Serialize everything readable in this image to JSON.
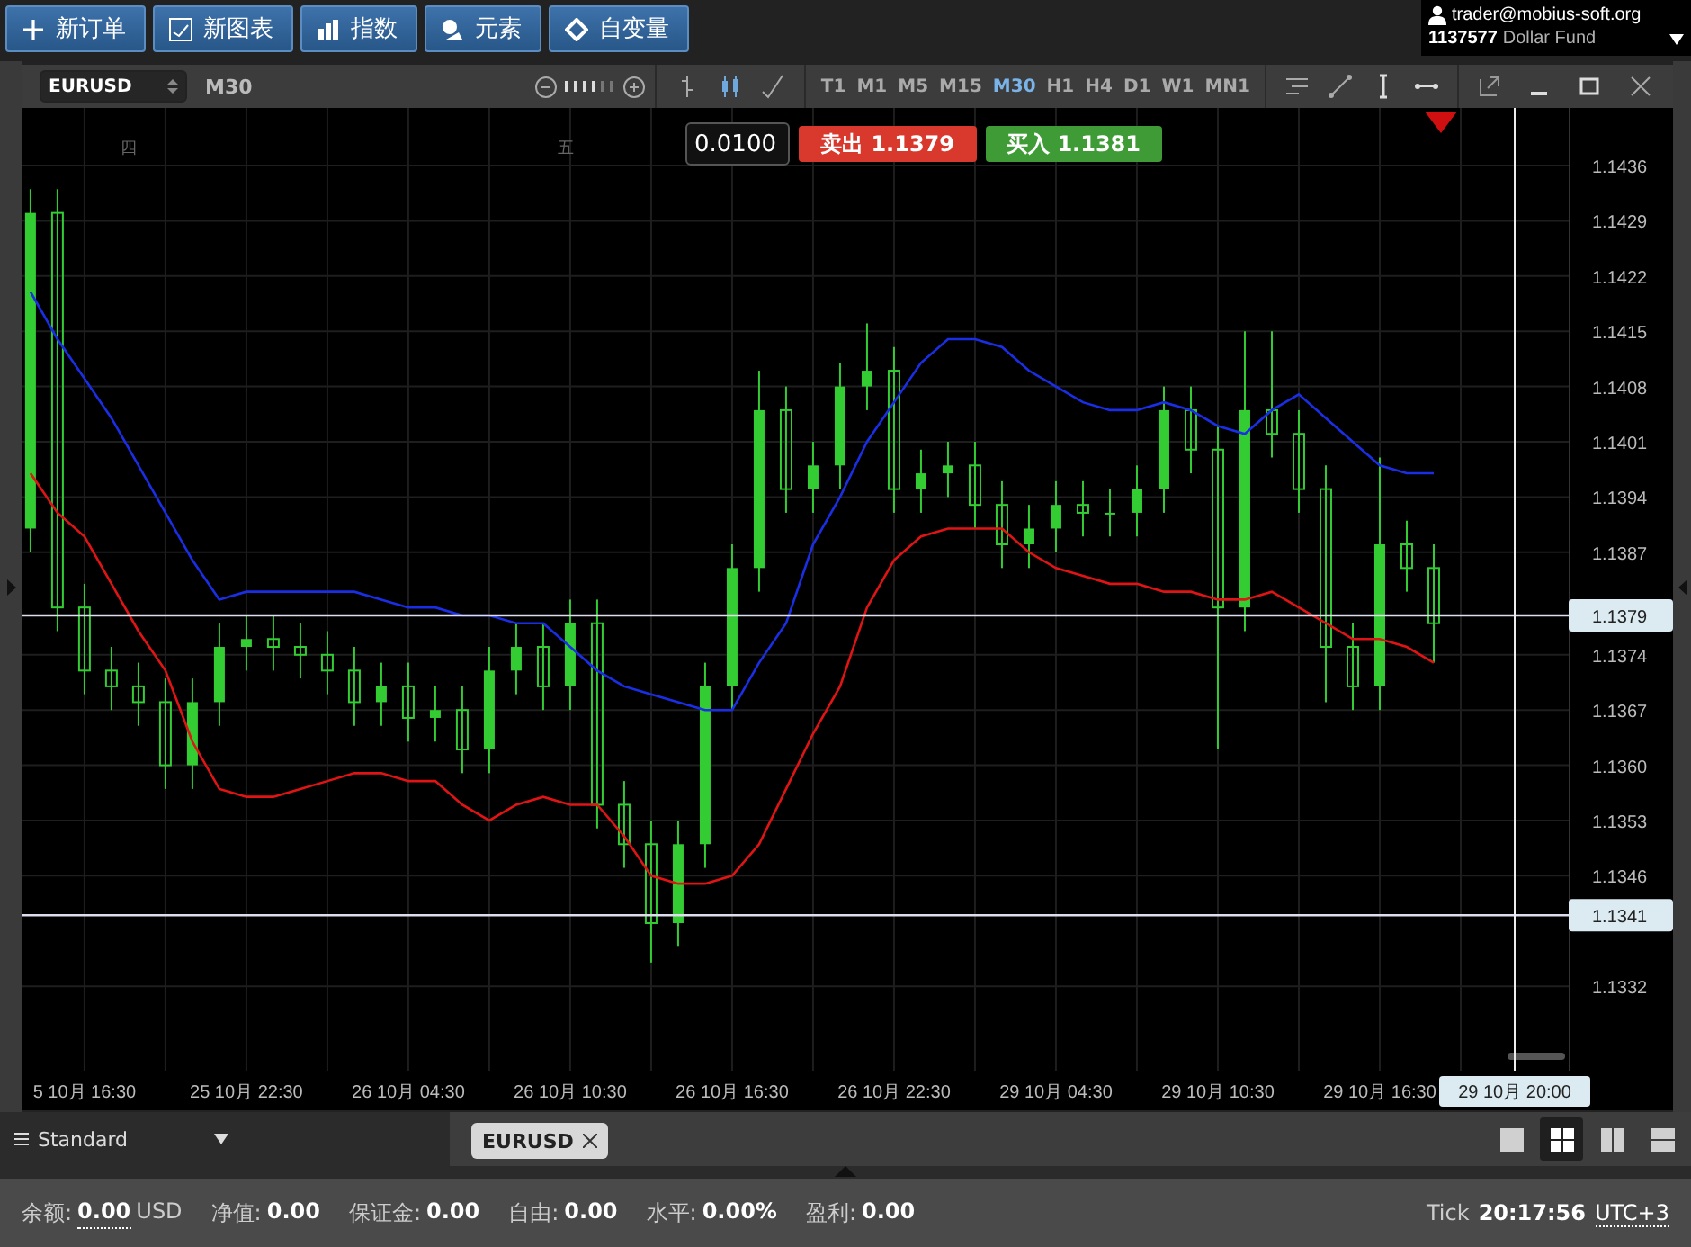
{
  "toolbar": {
    "buttons": [
      {
        "label": "新订单",
        "kind": "plus"
      },
      {
        "label": "新图表",
        "kind": "chart"
      },
      {
        "label": "指数",
        "kind": "bars"
      },
      {
        "label": "元素",
        "kind": "shapes"
      },
      {
        "label": "自变量",
        "kind": "diamond"
      }
    ]
  },
  "account": {
    "email": "trader@mobius-soft.org",
    "number": "1137577",
    "name": "Dollar Fund"
  },
  "chart_window": {
    "symbol": "EURUSD",
    "period": "M30",
    "timeframes": [
      {
        "label": "T1",
        "selected": false
      },
      {
        "label": "M1",
        "selected": false
      },
      {
        "label": "M5",
        "selected": false
      },
      {
        "label": "M15",
        "selected": false
      },
      {
        "label": "M30",
        "selected": true
      },
      {
        "label": "H1",
        "selected": false
      },
      {
        "label": "H4",
        "selected": false
      },
      {
        "label": "D1",
        "selected": false
      },
      {
        "label": "W1",
        "selected": false
      },
      {
        "label": "MN1",
        "selected": false
      }
    ],
    "order_panel": {
      "lot": "0.0100",
      "sell": {
        "label": "卖出",
        "price": "1.1379"
      },
      "buy": {
        "label": "买入",
        "price": "1.1381"
      }
    },
    "day_marks": [
      {
        "label": "四"
      },
      {
        "label": "五"
      }
    ],
    "crosshair": {
      "time": "29 10月 20:00"
    },
    "chart_data": {
      "type": "candlestick",
      "grid": true,
      "categories": [
        null,
        null,
        "5 10月 16:30",
        null,
        null,
        null,
        null,
        null,
        "25 10月 22:30",
        null,
        null,
        null,
        null,
        null,
        "26 10月 04:30",
        null,
        null,
        null,
        null,
        null,
        "26 10月 10:30",
        null,
        null,
        null,
        null,
        null,
        "26 10月 16:30",
        null,
        null,
        null,
        null,
        null,
        "26 10月 22:30",
        null,
        null,
        null,
        null,
        null,
        "29 10月 04:30",
        null,
        null,
        null,
        null,
        null,
        "29 10月 10:30",
        null,
        null,
        null,
        null,
        null,
        "29 10月 16:30",
        null,
        null,
        null,
        null,
        null
      ],
      "ohlc": [
        [
          1.139,
          1.1433,
          1.1387,
          1.143
        ],
        [
          1.143,
          1.1433,
          1.1377,
          1.138
        ],
        [
          1.138,
          1.1383,
          1.1369,
          1.1372
        ],
        [
          1.1372,
          1.1375,
          1.1367,
          1.137
        ],
        [
          1.137,
          1.1373,
          1.1365,
          1.1368
        ],
        [
          1.1368,
          1.1371,
          1.1357,
          1.136
        ],
        [
          1.136,
          1.1371,
          1.1357,
          1.1368
        ],
        [
          1.1368,
          1.1378,
          1.1365,
          1.1375
        ],
        [
          1.1375,
          1.1379,
          1.1372,
          1.1376
        ],
        [
          1.1376,
          1.1379,
          1.1372,
          1.1375
        ],
        [
          1.1375,
          1.1378,
          1.1371,
          1.1374
        ],
        [
          1.1374,
          1.1377,
          1.1369,
          1.1372
        ],
        [
          1.1372,
          1.1375,
          1.1365,
          1.1368
        ],
        [
          1.1368,
          1.1373,
          1.1365,
          1.137
        ],
        [
          1.137,
          1.1373,
          1.1363,
          1.1366
        ],
        [
          1.1366,
          1.137,
          1.1363,
          1.1367
        ],
        [
          1.1367,
          1.137,
          1.1359,
          1.1362
        ],
        [
          1.1362,
          1.1375,
          1.1359,
          1.1372
        ],
        [
          1.1372,
          1.1378,
          1.1369,
          1.1375
        ],
        [
          1.1375,
          1.1378,
          1.1367,
          1.137
        ],
        [
          1.137,
          1.1381,
          1.1367,
          1.1378
        ],
        [
          1.1378,
          1.1381,
          1.1352,
          1.1355
        ],
        [
          1.1355,
          1.1358,
          1.1347,
          1.135
        ],
        [
          1.135,
          1.1353,
          1.1335,
          1.134
        ],
        [
          1.134,
          1.1353,
          1.1337,
          1.135
        ],
        [
          1.135,
          1.1373,
          1.1347,
          1.137
        ],
        [
          1.137,
          1.1388,
          1.1367,
          1.1385
        ],
        [
          1.1385,
          1.141,
          1.1382,
          1.1405
        ],
        [
          1.1405,
          1.1408,
          1.1392,
          1.1395
        ],
        [
          1.1395,
          1.1401,
          1.1392,
          1.1398
        ],
        [
          1.1398,
          1.1411,
          1.1395,
          1.1408
        ],
        [
          1.1408,
          1.1416,
          1.1405,
          1.141
        ],
        [
          1.141,
          1.1413,
          1.1392,
          1.1395
        ],
        [
          1.1395,
          1.14,
          1.1392,
          1.1397
        ],
        [
          1.1397,
          1.1401,
          1.1394,
          1.1398
        ],
        [
          1.1398,
          1.1401,
          1.139,
          1.1393
        ],
        [
          1.1393,
          1.1396,
          1.1385,
          1.1388
        ],
        [
          1.1388,
          1.1393,
          1.1385,
          1.139
        ],
        [
          1.139,
          1.1396,
          1.1387,
          1.1393
        ],
        [
          1.1393,
          1.1396,
          1.1389,
          1.1392
        ],
        [
          1.1392,
          1.1395,
          1.1389,
          1.1392
        ],
        [
          1.1392,
          1.1398,
          1.1389,
          1.1395
        ],
        [
          1.1395,
          1.1408,
          1.1392,
          1.1405
        ],
        [
          1.1405,
          1.1408,
          1.1397,
          1.14
        ],
        [
          1.14,
          1.1403,
          1.1362,
          1.138
        ],
        [
          1.138,
          1.1415,
          1.1377,
          1.1405
        ],
        [
          1.1405,
          1.1415,
          1.1399,
          1.1402
        ],
        [
          1.1402,
          1.1405,
          1.1392,
          1.1395
        ],
        [
          1.1395,
          1.1398,
          1.1368,
          1.1375
        ],
        [
          1.1375,
          1.1378,
          1.1367,
          1.137
        ],
        [
          1.137,
          1.1399,
          1.1367,
          1.1388
        ],
        [
          1.1388,
          1.1391,
          1.1382,
          1.1385
        ],
        [
          1.1385,
          1.1388,
          1.1373,
          1.1378
        ],
        null,
        null,
        null
      ],
      "series": [
        {
          "type": "line",
          "color": "#1a2ee6",
          "values": [
            1.142,
            1.1414,
            1.1409,
            1.1404,
            1.1398,
            1.1392,
            1.1386,
            1.1381,
            1.1382,
            1.1382,
            1.1382,
            1.1382,
            1.1382,
            1.1381,
            1.138,
            1.138,
            1.1379,
            1.1379,
            1.1378,
            1.1378,
            1.1375,
            1.1372,
            1.137,
            1.1369,
            1.1368,
            1.1367,
            1.1367,
            1.1373,
            1.1378,
            1.1388,
            1.1394,
            1.1401,
            1.1406,
            1.1411,
            1.1414,
            1.1414,
            1.1413,
            1.141,
            1.1408,
            1.1406,
            1.1405,
            1.1405,
            1.1406,
            1.1405,
            1.1403,
            1.1402,
            1.1405,
            1.1407,
            1.1404,
            1.1401,
            1.1398,
            1.1397,
            1.1397,
            null,
            null,
            null
          ]
        },
        {
          "type": "line",
          "color": "#e01414",
          "values": [
            1.1397,
            1.1392,
            1.1389,
            1.1383,
            1.1377,
            1.1372,
            1.1363,
            1.1357,
            1.1356,
            1.1356,
            1.1357,
            1.1358,
            1.1359,
            1.1359,
            1.1358,
            1.1358,
            1.1355,
            1.1353,
            1.1355,
            1.1356,
            1.1355,
            1.1355,
            1.1351,
            1.1346,
            1.1345,
            1.1345,
            1.1346,
            1.135,
            1.1357,
            1.1364,
            1.137,
            1.138,
            1.1386,
            1.1389,
            1.139,
            1.139,
            1.139,
            1.1387,
            1.1385,
            1.1384,
            1.1383,
            1.1383,
            1.1382,
            1.1382,
            1.1381,
            1.1381,
            1.1382,
            1.138,
            1.1378,
            1.1376,
            1.1376,
            1.1375,
            1.1373,
            null,
            null,
            null
          ]
        }
      ],
      "ylim": [
        1.13213,
        1.14433
      ],
      "yticks": [
        {
          "value": 1.1436,
          "label": "1.1436"
        },
        {
          "value": 1.1429,
          "label": "1.1429"
        },
        {
          "value": 1.1422,
          "label": "1.1422"
        },
        {
          "value": 1.1415,
          "label": "1.1415"
        },
        {
          "value": 1.1408,
          "label": "1.1408"
        },
        {
          "value": 1.1401,
          "label": "1.1401"
        },
        {
          "value": 1.1394,
          "label": "1.1394"
        },
        {
          "value": 1.1387,
          "label": "1.1387"
        },
        {
          "value": 1.1374,
          "label": "1.1374"
        },
        {
          "value": 1.1367,
          "label": "1.1367"
        },
        {
          "value": 1.136,
          "label": "1.1360"
        },
        {
          "value": 1.1353,
          "label": "1.1353"
        },
        {
          "value": 1.1346,
          "label": "1.1346"
        },
        {
          "value": 1.1332,
          "label": "1.1332"
        }
      ],
      "ref_lines": [
        {
          "axis": "y",
          "value": 1.1379,
          "label": "1.1379"
        },
        {
          "axis": "y",
          "value": 1.1341,
          "label": "1.1341"
        }
      ]
    }
  },
  "bottom_bar": {
    "profile": "Standard",
    "tabs": [
      {
        "label": "EURUSD"
      }
    ],
    "layouts": [
      {
        "kind": "single",
        "selected": false
      },
      {
        "kind": "grid",
        "selected": true
      },
      {
        "kind": "columns",
        "selected": false
      },
      {
        "kind": "rows",
        "selected": false
      }
    ]
  },
  "status_bar": {
    "fields": [
      {
        "label": "余额:",
        "value": "0.00",
        "unit": "USD"
      },
      {
        "label": "净值:",
        "value": "0.00"
      },
      {
        "label": "保证金:",
        "value": "0.00"
      },
      {
        "label": "自由:",
        "value": "0.00"
      },
      {
        "label": "水平:",
        "value": "0.00%"
      },
      {
        "label": "盈利:",
        "value": "0.00"
      }
    ],
    "tick_label": "Tick",
    "time": "20:17:56",
    "timezone": "UTC+3"
  }
}
